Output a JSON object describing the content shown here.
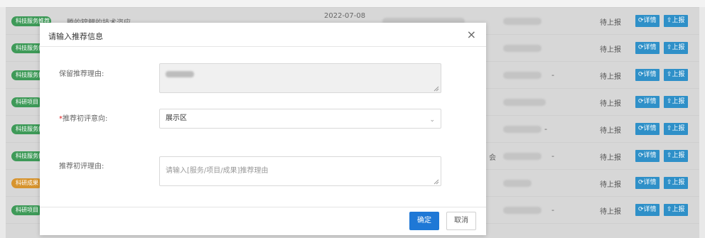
{
  "table": {
    "rows": [
      {
        "tag": "科技服务推荐",
        "tag_color": "green",
        "title": "腾的锦鲤的技术咨应",
        "date": "2022-07-08",
        "status": "待上报"
      },
      {
        "tag": "科技服务推荐",
        "tag_color": "green",
        "status": "待上报"
      },
      {
        "tag": "科技服务推荐",
        "tag_color": "green",
        "status": "待上报"
      },
      {
        "tag": "科研项目",
        "tag_color": "green",
        "status": "待上报"
      },
      {
        "tag": "科技服务推荐",
        "tag_color": "green",
        "status": "待上报"
      },
      {
        "tag": "科技服务推荐",
        "tag_color": "green",
        "status": "待上报",
        "extra": "会"
      },
      {
        "tag": "科研成果",
        "tag_color": "orange",
        "status": "待上报"
      },
      {
        "tag": "科研项目",
        "tag_color": "green",
        "status": "待上报"
      }
    ],
    "detail_label": "详情",
    "report_label": "上报"
  },
  "modal": {
    "title": "请输入推荐信息",
    "close_label": "×",
    "fields": {
      "recommend_reason_label": "保留推荐理由:",
      "initial_intent_label": "推荐初评意向:",
      "initial_intent_required": "*",
      "initial_intent_value": "展示区",
      "initial_reason_label": "推荐初评理由:",
      "initial_reason_placeholder": "请输入[服务/项目/成果]推荐理由"
    },
    "ok_label": "确定",
    "cancel_label": "取消"
  },
  "colors": {
    "accent": "#1f78d6",
    "tag_green": "#3e9a58",
    "tag_orange": "#d7942f",
    "action_button": "#2f90c8"
  }
}
